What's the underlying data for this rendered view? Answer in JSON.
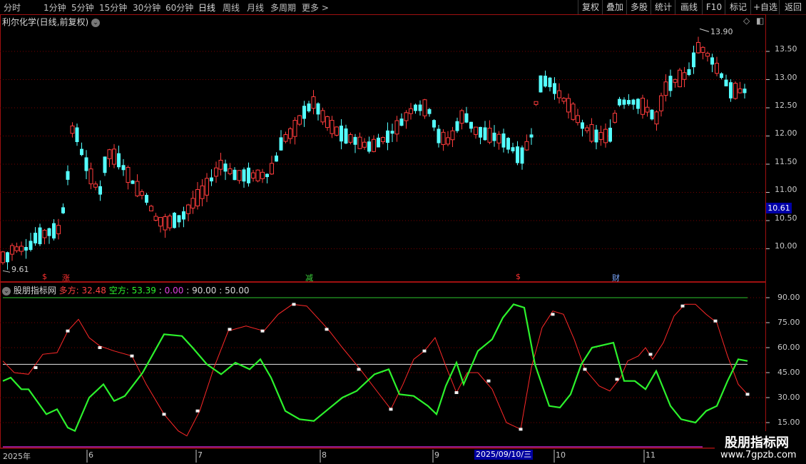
{
  "toolbar": {
    "periods": [
      "分时",
      "1分钟",
      "5分钟",
      "15分钟",
      "30分钟",
      "60分钟",
      "日线",
      "周线",
      "月线",
      "多周期",
      "更多 >"
    ],
    "active_period": "日线",
    "right_buttons": [
      "复权",
      "叠加",
      "多股",
      "统计",
      "画线",
      "F10",
      "标记",
      "+自选",
      "返回"
    ]
  },
  "main_chart": {
    "title": "利尔化学(日线,前复权)",
    "y_ticks": [
      "13.50",
      "13.00",
      "12.50",
      "12.00",
      "11.50",
      "11.00",
      "10.50",
      "10.00"
    ],
    "current_price": "10.61",
    "high_label": "13.90",
    "low_label": "9.61",
    "signals": [
      {
        "text": "$",
        "color": "#ff3030",
        "x": 62
      },
      {
        "text": "涨",
        "color": "#ff3030",
        "x": 88
      },
      {
        "text": "减",
        "color": "#3cd23c",
        "x": 428
      },
      {
        "text": "$",
        "color": "#ff3030",
        "x": 725
      },
      {
        "text": "财",
        "color": "#7aa7ff",
        "x": 858
      }
    ]
  },
  "indicator": {
    "name": "股朋指标网",
    "line1_label": "多方: 32.48",
    "line2_label": "空方: 53.39",
    "v3": "0.00",
    "v4": "90.00",
    "v5": "50.00",
    "y_ticks": [
      "90.00",
      "75.00",
      "60.00",
      "45.00",
      "30.00",
      "15.00"
    ]
  },
  "time_axis": {
    "labels": [
      "2025年",
      "6",
      "7",
      "8",
      "9",
      "10",
      "11"
    ],
    "cursor_date": "2025/09/10/三"
  },
  "colors": {
    "up": "#ff3c3c",
    "down": "#54ffff",
    "long_line": "#ff2828",
    "short_line": "#2cf22c",
    "grid": "#7a0000",
    "frame": "#a01010"
  },
  "watermark": {
    "title": "股朋指标网",
    "url": "www.7gpzb.com"
  }
}
